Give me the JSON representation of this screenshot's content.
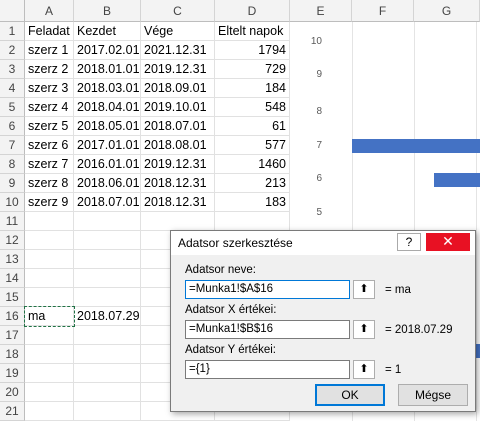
{
  "columns": [
    "A",
    "B",
    "C",
    "D",
    "E",
    "F",
    "G"
  ],
  "rows": [
    [
      "Feladat",
      "Kezdet",
      "Vége",
      "Eltelt napok"
    ],
    [
      "szerz 1",
      "2017.02.01",
      "2021.12.31",
      "1794"
    ],
    [
      "szerz 2",
      "2018.01.01",
      "2019.12.31",
      "729"
    ],
    [
      "szerz 3",
      "2018.03.01",
      "2018.09.01",
      "184"
    ],
    [
      "szerz 4",
      "2018.04.01",
      "2019.10.01",
      "548"
    ],
    [
      "szerz 5",
      "2018.05.01",
      "2018.07.01",
      "61"
    ],
    [
      "szerz 6",
      "2017.01.01",
      "2018.08.01",
      "577"
    ],
    [
      "szerz 7",
      "2016.01.01",
      "2019.12.31",
      "1460"
    ],
    [
      "szerz 8",
      "2018.06.01",
      "2018.12.31",
      "213"
    ],
    [
      "szerz 9",
      "2018.07.01",
      "2018.12.31",
      "183"
    ],
    [
      "",
      "",
      "",
      ""
    ],
    [
      "",
      "",
      "",
      ""
    ],
    [
      "",
      "",
      "",
      ""
    ],
    [
      "",
      "",
      "",
      ""
    ],
    [
      "",
      "",
      "",
      ""
    ],
    [
      "ma",
      "2018.07.29",
      "",
      ""
    ],
    [
      "",
      "",
      "",
      ""
    ],
    [
      "",
      "",
      "",
      ""
    ],
    [
      "",
      "",
      "",
      ""
    ],
    [
      "",
      "",
      "",
      ""
    ],
    [
      "",
      "",
      "",
      ""
    ]
  ],
  "row_numbers": [
    "1",
    "2",
    "3",
    "4",
    "5",
    "6",
    "7",
    "8",
    "9",
    "10",
    "11",
    "12",
    "13",
    "14",
    "15",
    "16",
    "17",
    "18",
    "19",
    "20",
    "21"
  ],
  "chart": {
    "y_ticks": [
      "10",
      "9",
      "8",
      "7",
      "6",
      "5"
    ],
    "bar_color": "#4472c4"
  },
  "dialog": {
    "title": "Adatsor szerkesztése",
    "help": "?",
    "close": "✕",
    "name_label": "Adatsor neve:",
    "name_value": "=Munka1!$A$16",
    "name_result": "= ma",
    "x_label": "Adatsor X értékei:",
    "x_value": "=Munka1!$B$16",
    "x_result": "= 2018.07.29",
    "y_label": "Adatsor Y értékei:",
    "y_value": "={1}",
    "y_result": "= 1",
    "ok": "OK",
    "cancel": "Mégse",
    "collapse_icon": "⬆"
  }
}
